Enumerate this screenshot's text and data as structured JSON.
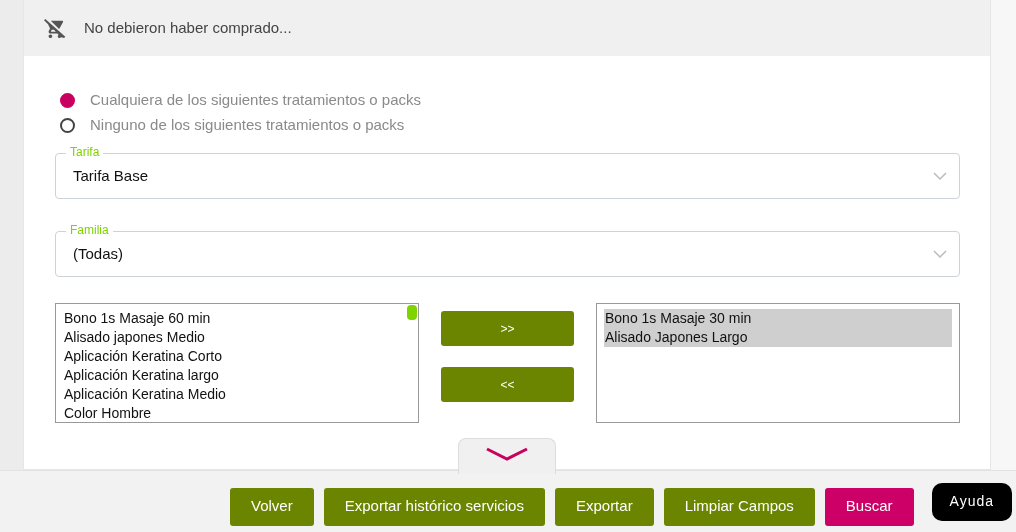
{
  "header": {
    "title": "No debieron haber comprado..."
  },
  "options": [
    {
      "label": "Cualquiera de los siguientes tratamientos o packs",
      "selected": true
    },
    {
      "label": "Ninguno de los siguientes tratamientos o packs",
      "selected": false
    }
  ],
  "fields": [
    {
      "label": "Tarifa",
      "value": "Tarifa Base"
    },
    {
      "label": "Familia",
      "value": "(Todas)"
    }
  ],
  "available": {
    "items": [
      {
        "label": "Bono 1s Masaje 60 min",
        "selected": false
      },
      {
        "label": "Alisado japones Medio",
        "selected": false
      },
      {
        "label": "Aplicación Keratina Corto",
        "selected": false
      },
      {
        "label": "Aplicación Keratina largo",
        "selected": false
      },
      {
        "label": "Aplicación Keratina Medio",
        "selected": false
      },
      {
        "label": "Color Hombre",
        "selected": false
      }
    ]
  },
  "transfer_buttons": [
    ">>",
    "<<"
  ],
  "chosen": {
    "items": [
      {
        "label": "Bono 1s Masaje 30 min",
        "selected": true
      },
      {
        "label": "Alisado Japones Largo",
        "selected": true
      }
    ]
  },
  "actions": [
    {
      "label": "Volver",
      "kind": "primary"
    },
    {
      "label": "Exportar histórico servicios",
      "kind": "primary"
    },
    {
      "label": "Exportar",
      "kind": "primary"
    },
    {
      "label": "Limpiar Campos",
      "kind": "primary"
    },
    {
      "label": "Buscar",
      "kind": "accent"
    },
    {
      "label": "Ayuda",
      "kind": "help"
    }
  ]
}
